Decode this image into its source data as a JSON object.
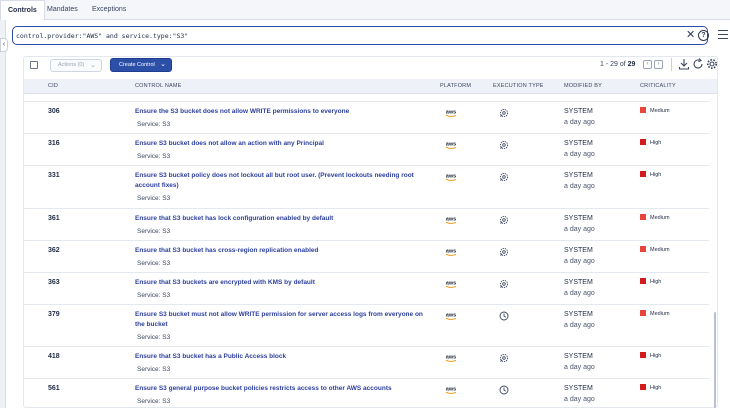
{
  "tabs": [
    {
      "label": "Controls",
      "active": true
    },
    {
      "label": "Mandates",
      "active": false
    },
    {
      "label": "Exceptions",
      "active": false
    }
  ],
  "search": {
    "value": "control.provider:\"AWS\" and service.type:\"S3\"",
    "clear_icon": "close-icon",
    "help_icon": "help-icon"
  },
  "toolbar": {
    "actions_label": "Actions (0)",
    "create_label": "Create Control"
  },
  "pagination": {
    "range": "1 - 29",
    "of_label": "of",
    "total": "29"
  },
  "table": {
    "headers": {
      "cid": "CID",
      "name": "CONTROL NAME",
      "platform": "PLATFORM",
      "execution": "EXECUTION TYPE",
      "modified": "MODIFIED BY",
      "criticality": "CRITICALITY"
    },
    "rows": [
      {
        "cid": "306",
        "name": "Ensure the S3 bucket does not allow WRITE permissions to everyone",
        "service": "Service: S3",
        "platform": "aws",
        "execution_icon": "gear-refresh-icon",
        "modified_by": "SYSTEM",
        "modified_when": "a day ago",
        "criticality": "Medium",
        "crit_color": "#e8453c"
      },
      {
        "cid": "316",
        "name": "Ensure S3 bucket does not allow an action with any Principal",
        "service": "Service: S3",
        "platform": "aws",
        "execution_icon": "gear-refresh-icon",
        "modified_by": "SYSTEM",
        "modified_when": "a day ago",
        "criticality": "High",
        "crit_color": "#d01c1c"
      },
      {
        "cid": "331",
        "name": "Ensure S3 bucket policy does not lockout all but root user. (Prevent lockouts needing root account fixes)",
        "service": "Service: S3",
        "platform": "aws",
        "execution_icon": "gear-refresh-icon",
        "modified_by": "SYSTEM",
        "modified_when": "a day ago",
        "criticality": "High",
        "crit_color": "#d01c1c"
      },
      {
        "cid": "361",
        "name": "Ensure that S3 bucket has lock configuration enabled by default",
        "service": "Service: S3",
        "platform": "aws",
        "execution_icon": "gear-refresh-icon",
        "modified_by": "SYSTEM",
        "modified_when": "a day ago",
        "criticality": "Medium",
        "crit_color": "#e8453c"
      },
      {
        "cid": "362",
        "name": "Ensure that S3 bucket has cross-region replication enabled",
        "service": "Service: S3",
        "platform": "aws",
        "execution_icon": "gear-refresh-icon",
        "modified_by": "SYSTEM",
        "modified_when": "a day ago",
        "criticality": "Medium",
        "crit_color": "#e8453c"
      },
      {
        "cid": "363",
        "name": "Ensure that S3 buckets are encrypted with KMS by default",
        "service": "Service: S3",
        "platform": "aws",
        "execution_icon": "gear-refresh-icon",
        "modified_by": "SYSTEM",
        "modified_when": "a day ago",
        "criticality": "High",
        "crit_color": "#d01c1c"
      },
      {
        "cid": "379",
        "name": "Ensure S3 bucket must not allow WRITE permission for server access logs from everyone on the bucket",
        "service": "Service: S3",
        "platform": "aws",
        "execution_icon": "clock-icon",
        "modified_by": "SYSTEM",
        "modified_when": "a day ago",
        "criticality": "Medium",
        "crit_color": "#e8453c"
      },
      {
        "cid": "418",
        "name": "Ensure that S3 bucket has a Public Access block",
        "service": "Service: S3",
        "platform": "aws",
        "execution_icon": "gear-refresh-icon",
        "modified_by": "SYSTEM",
        "modified_when": "a day ago",
        "criticality": "High",
        "crit_color": "#d01c1c"
      },
      {
        "cid": "561",
        "name": "Ensure S3 general purpose bucket policies restricts access to other AWS accounts",
        "service": "Service: S3",
        "platform": "aws",
        "execution_icon": "clock-icon",
        "modified_by": "SYSTEM",
        "modified_when": "a day ago",
        "criticality": "High",
        "crit_color": "#d01c1c"
      }
    ]
  },
  "colors": {
    "accent": "#2c4fa8",
    "link": "#2c3f9e",
    "aws_orange": "#f29100"
  }
}
